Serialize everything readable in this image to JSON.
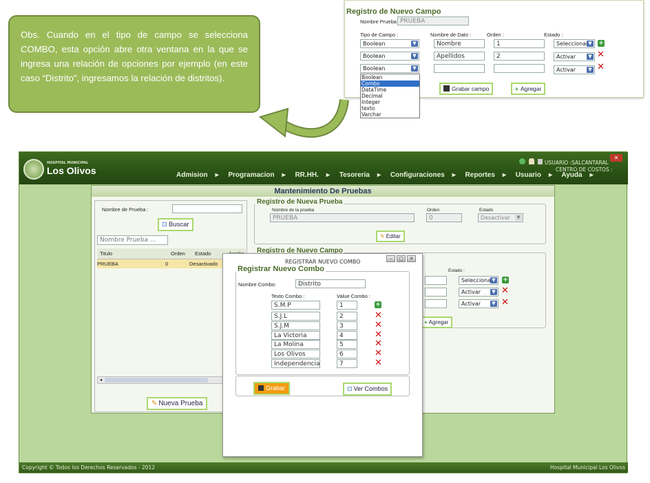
{
  "note": {
    "text": "Obs. Cuando en el tipo de campo se selecciona COMBO, esta opción abre otra ventana en la que se ingresa una relación de opciones por ejemplo (en este caso “Distrito”, ingresamos la relación de distritos)."
  },
  "inset": {
    "title": "Registro de Nuevo Campo",
    "nombre_prueba_label": "Nombre Prueba :",
    "nombre_prueba_value": "PRUEBA",
    "headers": {
      "tipo": "Tipo de Campo :",
      "nombre": "Nombre de Dato :",
      "orden": "Orden :",
      "estado": "Estado :"
    },
    "rows": [
      {
        "tipo": "Boolean",
        "nombre": "Nombre",
        "orden": "1",
        "estado": "Seleccionar"
      },
      {
        "tipo": "Boolean",
        "nombre": "Apellidos",
        "orden": "2",
        "estado": "Activar"
      },
      {
        "tipo": "Boolean",
        "nombre": "",
        "orden": "",
        "estado": "Activar"
      }
    ],
    "dropdown_options": [
      "Boolean",
      "Combo",
      "DataTime",
      "Decimal",
      "Integer",
      "texto",
      "Varchar"
    ],
    "dropdown_selected": "Combo",
    "grabar_campo": "Grabar campo",
    "agregar": "Agregar"
  },
  "app": {
    "logo_small": "HOSPITAL MUNICIPAL",
    "logo_big": "Los Olivos",
    "menu": [
      "Admision",
      "Programacion",
      "RR.HH.",
      "Tesoreria",
      "Configuraciones",
      "Reportes",
      "Usuario",
      "Ayuda"
    ],
    "usuario": "USUARIO :SALCANTARAL",
    "centro": "CENTRO DE COSTOS :",
    "footer_left": "Copyright © Todos los Derechos Reservados - 2012",
    "footer_right": "Hospital Municipal Los Olivos"
  },
  "panel": {
    "title": "Mantenimiento De Pruebas",
    "left": {
      "nombre_label": "Nombre de Prueba :",
      "buscar": "Buscar",
      "search_placeholder": "Nombre Prueba ...",
      "columns": [
        "Titulo",
        "Orden",
        "Estado",
        "Acción"
      ],
      "rows": [
        {
          "titulo": "PRUEBA",
          "orden": "0",
          "estado": "Desactivado"
        }
      ],
      "nueva_prueba": "Nueva Prueba"
    },
    "nueva_prueba": {
      "legend": "Registro de Nueva Prueba",
      "nombre_label": "Nombre de la prueba",
      "nombre_value": "PRUEBA",
      "orden_label": "Orden",
      "orden_value": "0",
      "estado_label": "Estado",
      "estado_value": "Desactivar",
      "editar": "Editar"
    },
    "nuevo_campo": {
      "legend": "Registro de Nuevo Campo",
      "estado_label": "Estado :",
      "estados": [
        "Seleccionar",
        "Activar",
        "Activar"
      ],
      "agregar": "Agregar"
    }
  },
  "modal": {
    "window_title": "REGISTRAR NUEVO COMBO",
    "legend": "Registrar Nuevo Combo",
    "nombre_label": "Nombre Combo:",
    "nombre_value": "Distrito",
    "texto_header": "Texto Combo :",
    "value_header": "Value Combo :",
    "rows": [
      {
        "texto": "S.M.P",
        "value": "1"
      },
      {
        "texto": "S.J.L",
        "value": "2"
      },
      {
        "texto": "S.J.M",
        "value": "3"
      },
      {
        "texto": "La Victoria",
        "value": "4"
      },
      {
        "texto": "La Molina",
        "value": "5"
      },
      {
        "texto": "Los Olivos",
        "value": "6"
      },
      {
        "texto": "Independencia",
        "value": "7"
      }
    ],
    "grabar": "Grabar",
    "ver_combos": "Ver Combos"
  },
  "colors": {
    "note_bg": "#9bbb59",
    "app_bg": "#bad79c",
    "header_bg": "#2b5215",
    "accent_orange": "#f39c12"
  }
}
